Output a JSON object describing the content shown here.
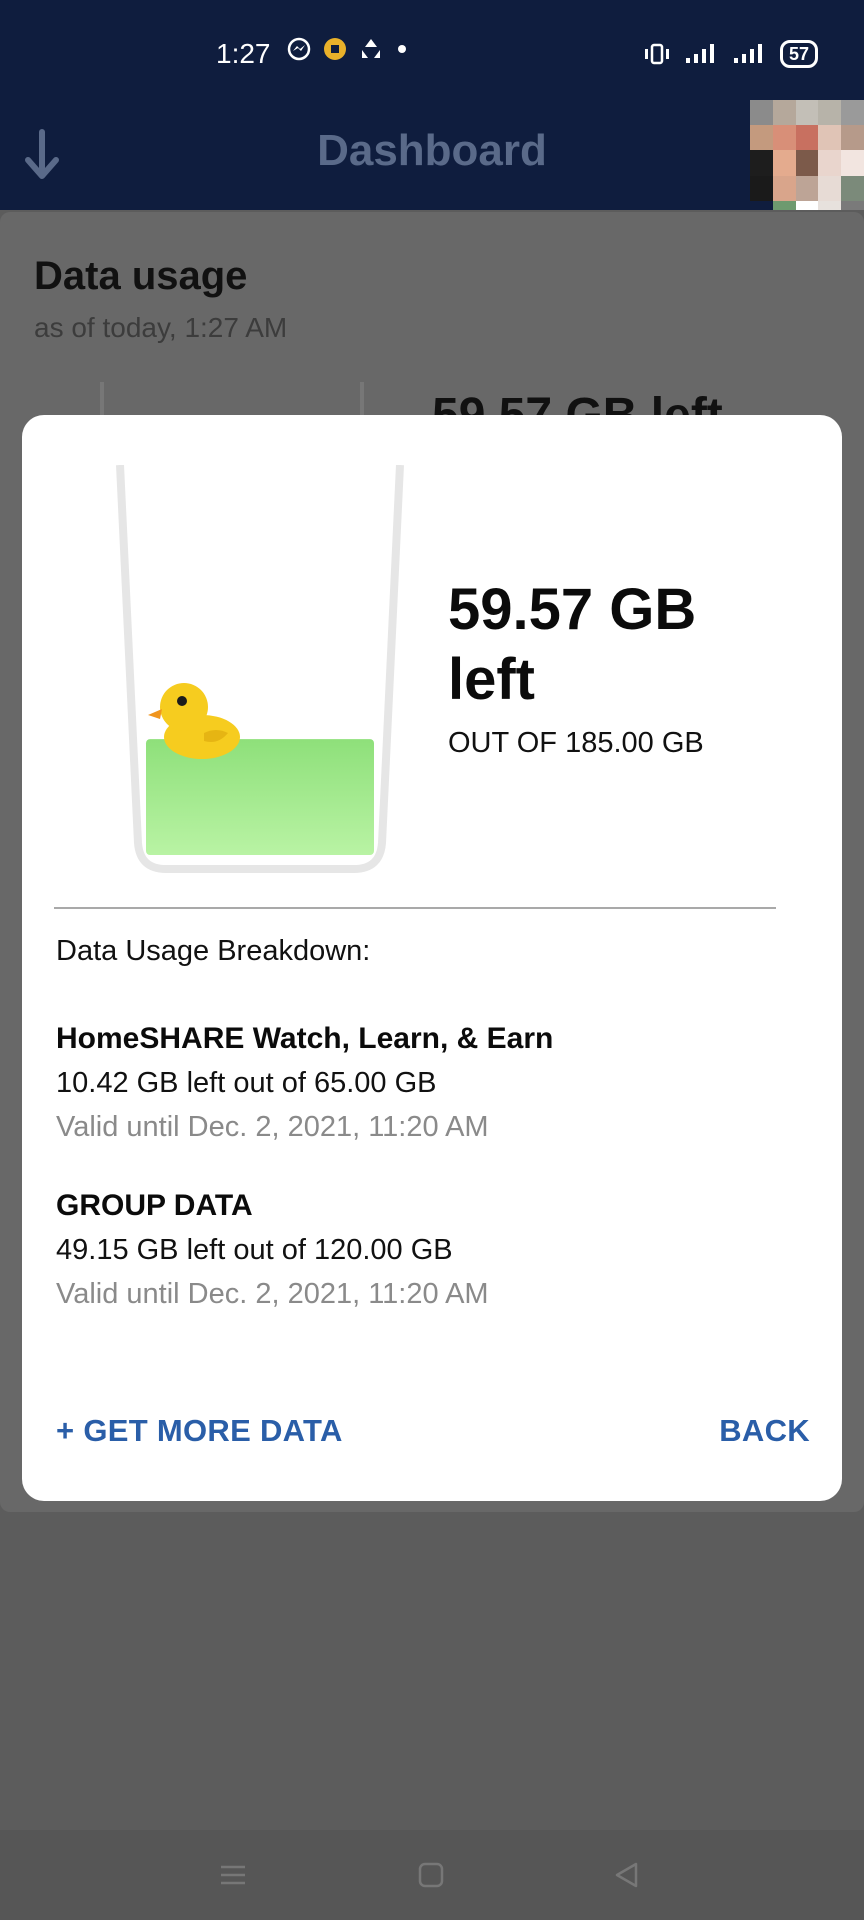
{
  "status_bar": {
    "time": "1:27",
    "battery": "57"
  },
  "app_bar": {
    "title": "Dashboard"
  },
  "background_card": {
    "heading": "Data usage",
    "subheading": "as of today, 1:27 AM",
    "peek_text": "59.57 GB left"
  },
  "dialog": {
    "remaining_value": "59.57 GB",
    "remaining_suffix": "left",
    "total_label": "OUT OF 185.00 GB",
    "fill_fraction": 0.322,
    "breakdown_title": "Data Usage Breakdown:",
    "plans": [
      {
        "name": "HomeSHARE Watch, Learn, & Earn",
        "usage": "10.42 GB left out of 65.00 GB",
        "validity": "Valid until Dec. 2, 2021, 11:20 AM"
      },
      {
        "name": "GROUP DATA",
        "usage": "49.15 GB left out of 120.00 GB",
        "validity": "Valid until Dec. 2, 2021, 11:20 AM"
      }
    ],
    "get_more_label": "+ GET MORE DATA",
    "back_label": "BACK"
  },
  "colors": {
    "app_bar_bg": "#0f1d3e",
    "water": "#8ee07a",
    "duck": "#f6cc1f",
    "action_text": "#2a5ea8"
  },
  "icons": {
    "status_left": [
      "messenger-icon",
      "notification-icon",
      "sync-icon"
    ],
    "status_right": [
      "vibrate-icon",
      "signal-icon",
      "signal-icon",
      "battery-icon"
    ],
    "app_bar": "arrow-down-icon",
    "nav": [
      "menu-icon",
      "home-icon",
      "back-triangle-icon"
    ]
  }
}
